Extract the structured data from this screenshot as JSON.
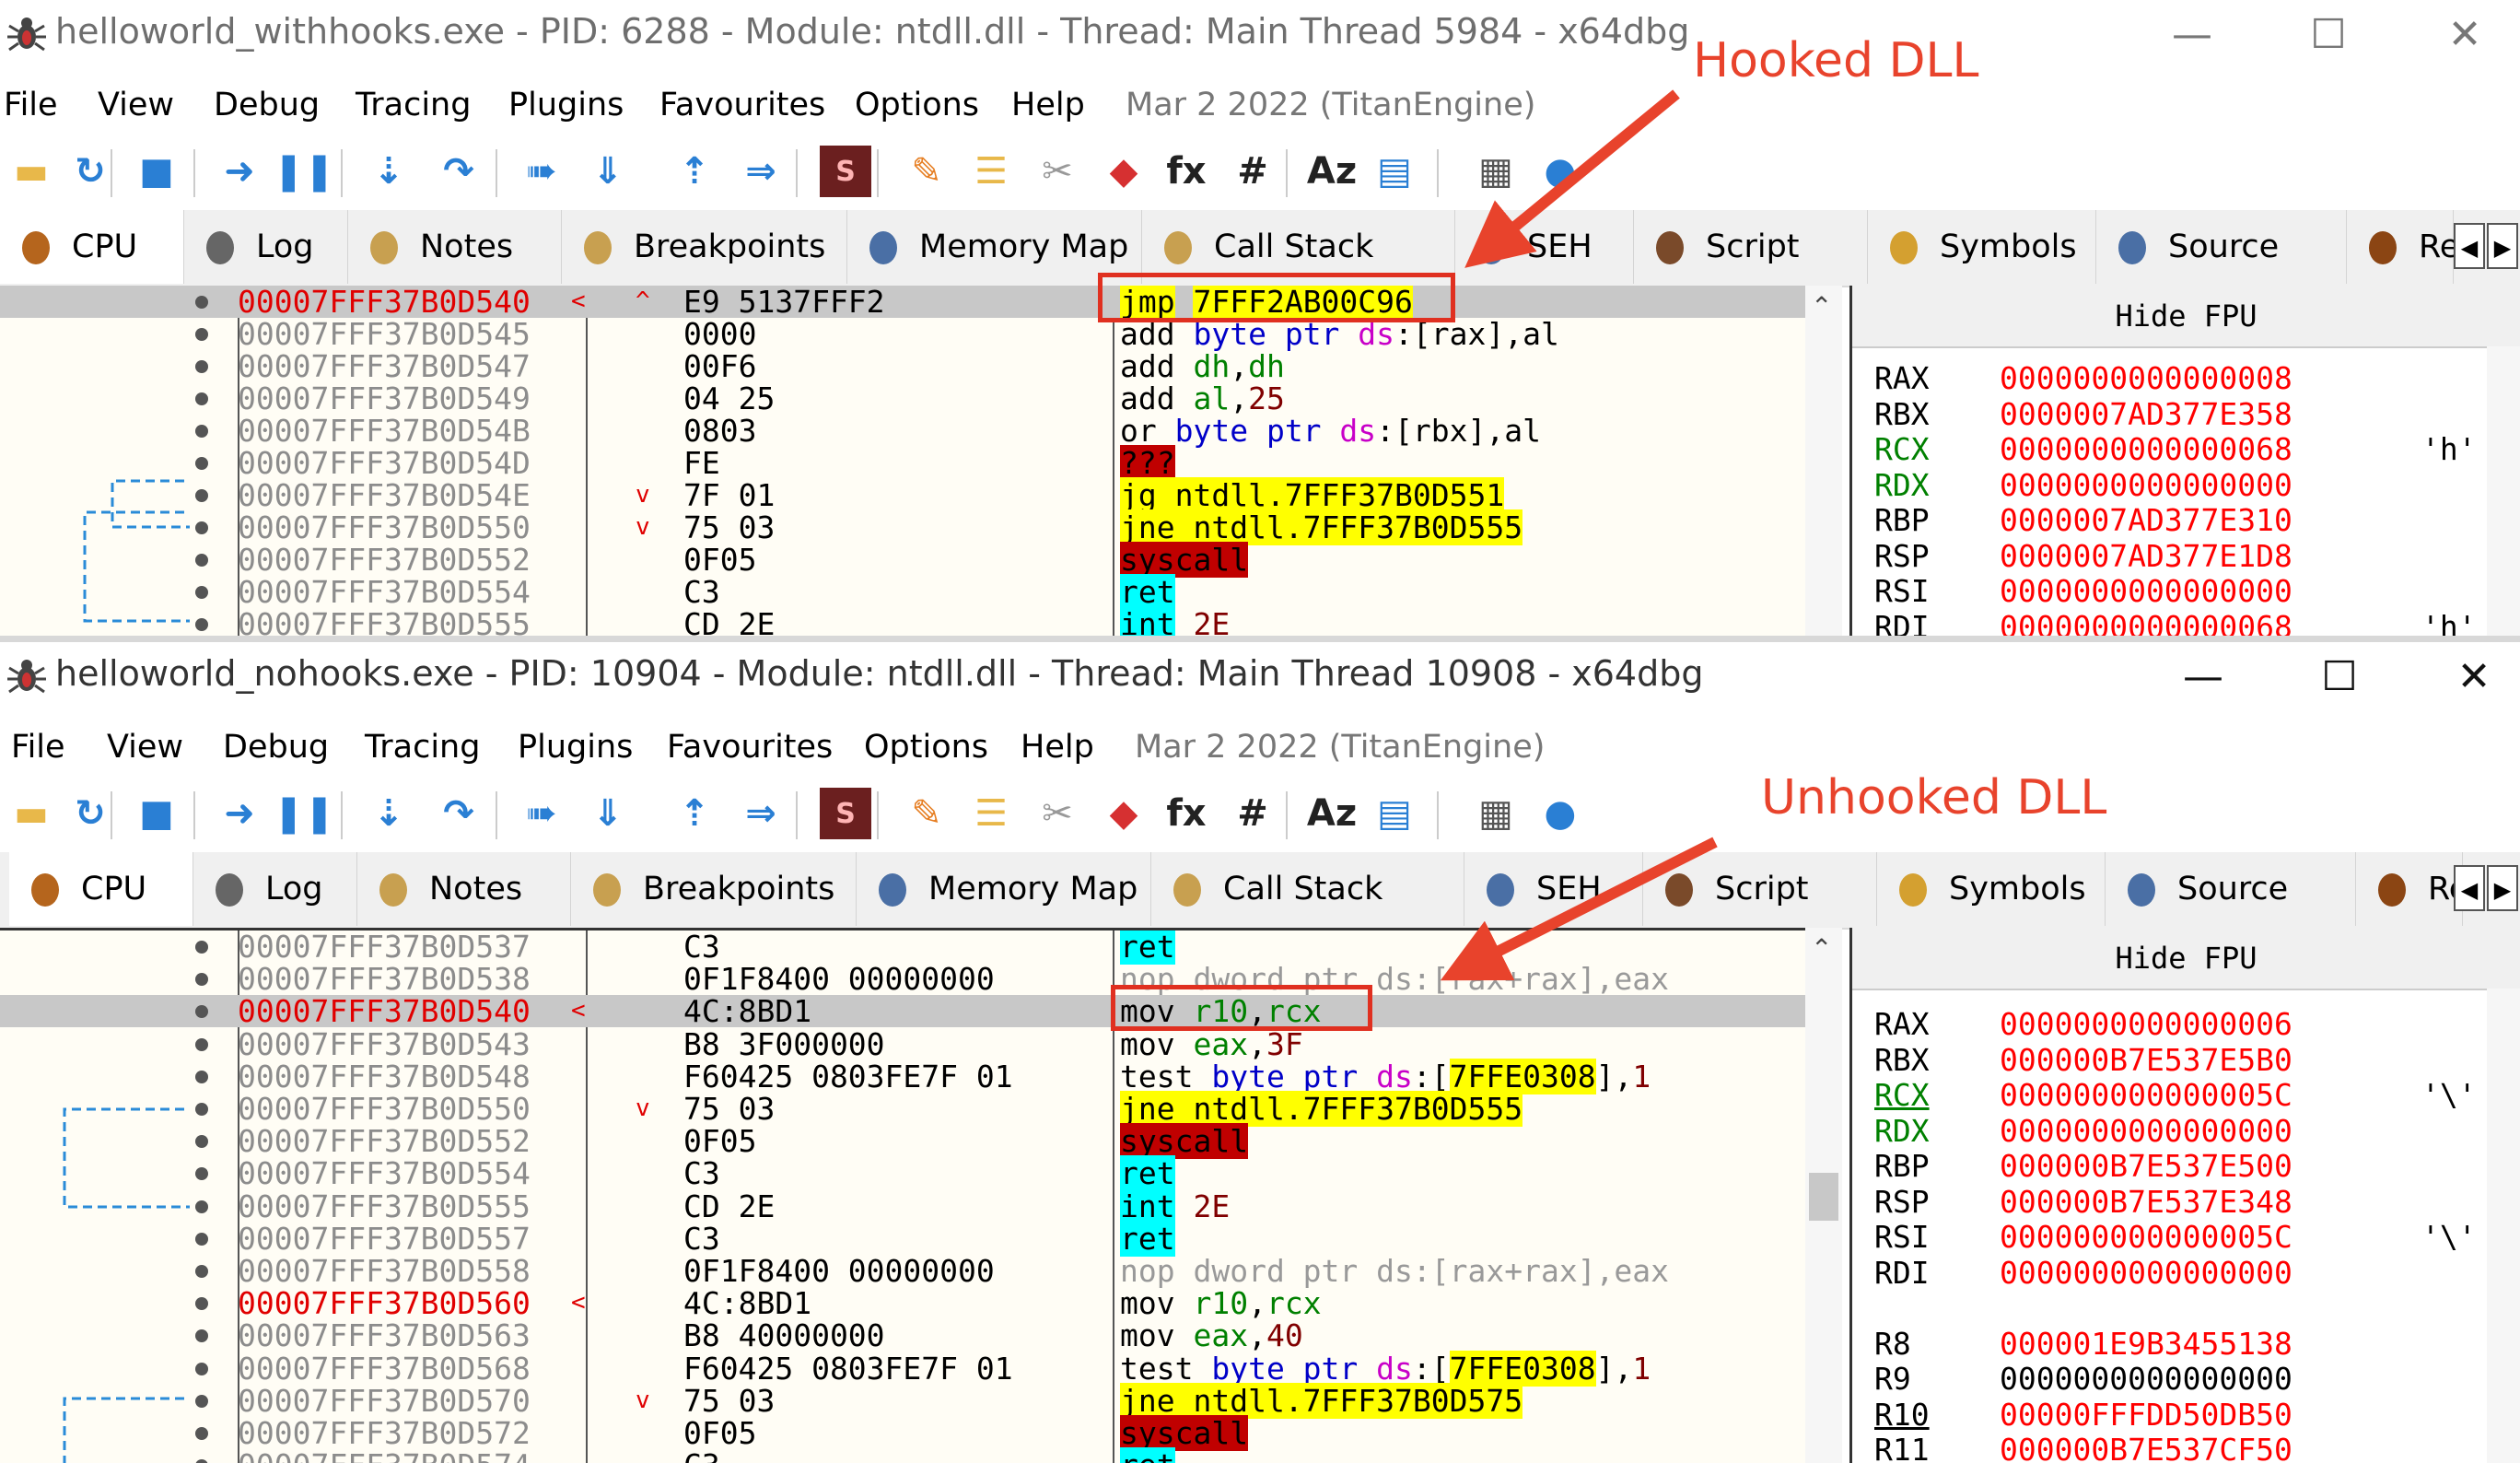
{
  "annotations": {
    "hooked_label": "Hooked DLL",
    "unhooked_label": "Unhooked DLL"
  },
  "colors": {
    "annotation": "#e8432c",
    "current_address": "#e00000",
    "register_value": "#ff0000",
    "highlight_yellow": "#ffff00",
    "highlight_cyan": "#00ffff",
    "highlight_red": "#c00000"
  },
  "menu": [
    "File",
    "View",
    "Debug",
    "Tracing",
    "Plugins",
    "Favourites",
    "Options",
    "Help"
  ],
  "build_date": "Mar 2 2022 (TitanEngine)",
  "toolbar_icons": [
    "open-icon",
    "restart-icon",
    "stop-icon",
    "run-icon",
    "pause-icon",
    "step-into-icon",
    "step-over-icon",
    "trace-into-icon",
    "trace-over-icon",
    "execute-till-return-icon",
    "run-to-user-code-icon",
    "scylla-icon",
    "patch-icon",
    "comment-icon",
    "label-icon",
    "bookmark-icon",
    "function-icon",
    "hash-icon",
    "font-icon",
    "log-icon",
    "calculator-icon",
    "globe-icon"
  ],
  "window1": {
    "title": "helloworld_withhooks.exe - PID: 6288 - Module: ntdll.dll - Thread: Main Thread 5984 - x64dbg",
    "tabs": [
      "CPU",
      "Log",
      "Notes",
      "Breakpoints",
      "Memory Map",
      "Call Stack",
      "SEH",
      "Script",
      "Symbols",
      "Source",
      "Re"
    ],
    "rows": [
      {
        "addr": "00007FFF37B0D540",
        "cur": true,
        "mark": "<",
        "jmp": "^",
        "bytes": "E9 5137FFF2",
        "instr": [
          [
            "hl-y",
            "jmp"
          ],
          [
            "mn",
            " "
          ],
          [
            "hl-y",
            "7FFF2AB00C96"
          ]
        ],
        "sel": true
      },
      {
        "addr": "00007FFF37B0D545",
        "bytes": "0000",
        "instr": [
          [
            "mn",
            "add "
          ],
          [
            "kw",
            "byte ptr "
          ],
          [
            "sg",
            "ds"
          ],
          [
            "mn",
            ":[rax],al"
          ]
        ]
      },
      {
        "addr": "00007FFF37B0D547",
        "bytes": "00F6",
        "instr": [
          [
            "mn",
            "add "
          ],
          [
            "reg",
            "dh"
          ],
          [
            "mn",
            ","
          ],
          [
            "reg",
            "dh"
          ]
        ]
      },
      {
        "addr": "00007FFF37B0D549",
        "bytes": "04 25",
        "instr": [
          [
            "mn",
            "add "
          ],
          [
            "reg",
            "al"
          ],
          [
            "mn",
            ","
          ],
          [
            "num",
            "25"
          ]
        ]
      },
      {
        "addr": "00007FFF37B0D54B",
        "bytes": "0803",
        "instr": [
          [
            "mn",
            "or "
          ],
          [
            "kw",
            "byte ptr "
          ],
          [
            "sg",
            "ds"
          ],
          [
            "mn",
            ":[rbx],al"
          ]
        ]
      },
      {
        "addr": "00007FFF37B0D54D",
        "bytes": "FE",
        "instr": [
          [
            "hl-r",
            "???"
          ]
        ]
      },
      {
        "addr": "00007FFF37B0D54E",
        "jmp": "v",
        "bytes": "7F 01",
        "instr": [
          [
            "hl-y",
            "jg ntdll.7FFF37B0D551"
          ]
        ]
      },
      {
        "addr": "00007FFF37B0D550",
        "jmp": "v",
        "bytes": "75 03",
        "instr": [
          [
            "hl-y",
            "jne ntdll.7FFF37B0D555"
          ]
        ]
      },
      {
        "addr": "00007FFF37B0D552",
        "bytes": "0F05",
        "instr": [
          [
            "hl-r",
            "syscall"
          ]
        ]
      },
      {
        "addr": "00007FFF37B0D554",
        "bytes": "C3",
        "instr": [
          [
            "hl-c",
            "ret"
          ]
        ]
      },
      {
        "addr": "00007FFF37B0D555",
        "bytes": "CD 2E",
        "instr": [
          [
            "hl-c",
            "int"
          ],
          [
            "mn",
            " "
          ],
          [
            "num",
            "2E"
          ]
        ]
      }
    ],
    "registers": [
      {
        "name": "RAX",
        "value": "0000000000000008",
        "char": ""
      },
      {
        "name": "RBX",
        "value": "0000007AD377E358",
        "char": ""
      },
      {
        "name": "RCX",
        "value": "0000000000000068",
        "char": "'h'",
        "chg": true
      },
      {
        "name": "RDX",
        "value": "0000000000000000",
        "char": "",
        "chg": true
      },
      {
        "name": "RBP",
        "value": "0000007AD377E310",
        "char": ""
      },
      {
        "name": "RSP",
        "value": "0000007AD377E1D8",
        "char": ""
      },
      {
        "name": "RSI",
        "value": "0000000000000000",
        "char": ""
      },
      {
        "name": "RDI",
        "value": "0000000000000068",
        "char": "'h'"
      }
    ]
  },
  "window2": {
    "title": "helloworld_nohooks.exe - PID: 10904 - Module: ntdll.dll - Thread: Main Thread 10908 - x64dbg",
    "tabs": [
      "CPU",
      "Log",
      "Notes",
      "Breakpoints",
      "Memory Map",
      "Call Stack",
      "SEH",
      "Script",
      "Symbols",
      "Source",
      "Re"
    ],
    "rows": [
      {
        "addr": "00007FFF37B0D537",
        "bytes": "C3",
        "instr": [
          [
            "hl-c",
            "ret"
          ]
        ]
      },
      {
        "addr": "00007FFF37B0D538",
        "bytes": "0F1F8400 00000000",
        "instr": [
          [
            "gray",
            "nop dword ptr ds:[rax+rax],eax"
          ]
        ]
      },
      {
        "addr": "00007FFF37B0D540",
        "cur": true,
        "mark": "<",
        "bytes": "4C:8BD1",
        "instr": [
          [
            "mn",
            "mov "
          ],
          [
            "reg",
            "r10"
          ],
          [
            "mn",
            ","
          ],
          [
            "reg",
            "rcx"
          ]
        ],
        "sel": true
      },
      {
        "addr": "00007FFF37B0D543",
        "bytes": "B8 3F000000",
        "instr": [
          [
            "mn",
            "mov "
          ],
          [
            "reg",
            "eax"
          ],
          [
            "mn",
            ","
          ],
          [
            "num",
            "3F"
          ]
        ]
      },
      {
        "addr": "00007FFF37B0D548",
        "bytes": "F60425 0803FE7F 01",
        "instr": [
          [
            "mn",
            "test "
          ],
          [
            "kw",
            "byte ptr "
          ],
          [
            "sg",
            "ds"
          ],
          [
            "mn",
            ":["
          ],
          [
            "hl-y",
            "7FFE0308"
          ],
          [
            "mn",
            "],"
          ],
          [
            "num",
            "1"
          ]
        ]
      },
      {
        "addr": "00007FFF37B0D550",
        "jmp": "v",
        "bytes": "75 03",
        "instr": [
          [
            "hl-y",
            "jne ntdll.7FFF37B0D555"
          ]
        ]
      },
      {
        "addr": "00007FFF37B0D552",
        "bytes": "0F05",
        "instr": [
          [
            "hl-r",
            "syscall"
          ]
        ]
      },
      {
        "addr": "00007FFF37B0D554",
        "bytes": "C3",
        "instr": [
          [
            "hl-c",
            "ret"
          ]
        ]
      },
      {
        "addr": "00007FFF37B0D555",
        "bytes": "CD 2E",
        "instr": [
          [
            "hl-c",
            "int"
          ],
          [
            "mn",
            " "
          ],
          [
            "num",
            "2E"
          ]
        ]
      },
      {
        "addr": "00007FFF37B0D557",
        "bytes": "C3",
        "instr": [
          [
            "hl-c",
            "ret"
          ]
        ]
      },
      {
        "addr": "00007FFF37B0D558",
        "bytes": "0F1F8400 00000000",
        "instr": [
          [
            "gray",
            "nop dword ptr ds:[rax+rax],eax"
          ]
        ]
      },
      {
        "addr": "00007FFF37B0D560",
        "cur": true,
        "mark": "<",
        "bytes": "4C:8BD1",
        "instr": [
          [
            "mn",
            "mov "
          ],
          [
            "reg",
            "r10"
          ],
          [
            "mn",
            ","
          ],
          [
            "reg",
            "rcx"
          ]
        ]
      },
      {
        "addr": "00007FFF37B0D563",
        "bytes": "B8 40000000",
        "instr": [
          [
            "mn",
            "mov "
          ],
          [
            "reg",
            "eax"
          ],
          [
            "mn",
            ","
          ],
          [
            "num",
            "40"
          ]
        ]
      },
      {
        "addr": "00007FFF37B0D568",
        "bytes": "F60425 0803FE7F 01",
        "instr": [
          [
            "mn",
            "test "
          ],
          [
            "kw",
            "byte ptr "
          ],
          [
            "sg",
            "ds"
          ],
          [
            "mn",
            ":["
          ],
          [
            "hl-y",
            "7FFE0308"
          ],
          [
            "mn",
            "],"
          ],
          [
            "num",
            "1"
          ]
        ]
      },
      {
        "addr": "00007FFF37B0D570",
        "jmp": "v",
        "bytes": "75 03",
        "instr": [
          [
            "hl-y",
            "jne ntdll.7FFF37B0D575"
          ]
        ]
      },
      {
        "addr": "00007FFF37B0D572",
        "bytes": "0F05",
        "instr": [
          [
            "hl-r",
            "syscall"
          ]
        ]
      },
      {
        "addr": "00007FFF37B0D574",
        "bytes": "C3",
        "instr": [
          [
            "hl-c",
            "ret"
          ]
        ]
      }
    ],
    "registers": [
      {
        "name": "RAX",
        "value": "0000000000000006",
        "char": ""
      },
      {
        "name": "RBX",
        "value": "000000B7E537E5B0",
        "char": ""
      },
      {
        "name": "RCX",
        "value": "000000000000005C",
        "char": "'\\'",
        "chg": true,
        "und": true
      },
      {
        "name": "RDX",
        "value": "0000000000000000",
        "char": "",
        "chg": true
      },
      {
        "name": "RBP",
        "value": "000000B7E537E500",
        "char": ""
      },
      {
        "name": "RSP",
        "value": "000000B7E537E348",
        "char": ""
      },
      {
        "name": "RSI",
        "value": "000000000000005C",
        "char": "'\\'"
      },
      {
        "name": "RDI",
        "value": "0000000000000000",
        "char": ""
      },
      {
        "name": "",
        "value": "",
        "char": ""
      },
      {
        "name": "R8",
        "value": "000001E9B3455138",
        "char": ""
      },
      {
        "name": "R9",
        "value": "0000000000000000",
        "char": "",
        "blk": true
      },
      {
        "name": "R10",
        "value": "00000FFFDD50DB50",
        "char": "",
        "und": true
      },
      {
        "name": "R11",
        "value": "000000B7E537CF50",
        "char": ""
      }
    ]
  },
  "hide_fpu": "Hide FPU"
}
